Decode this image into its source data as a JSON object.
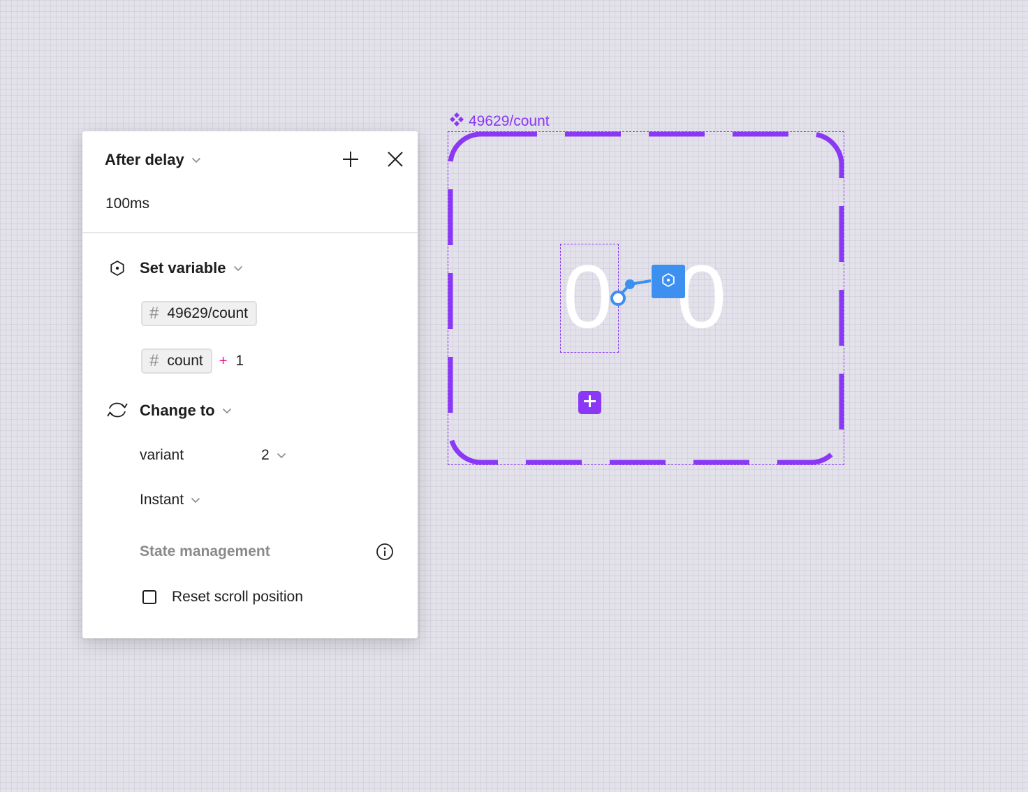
{
  "panel": {
    "trigger": {
      "label": "After delay",
      "delay_value": "100ms"
    },
    "set_variable": {
      "label": "Set variable",
      "target_variable": "49629/count",
      "expression": {
        "variable": "count",
        "operator": "+",
        "operand": "1"
      }
    },
    "change_to": {
      "label": "Change to",
      "property_label": "variant",
      "property_value": "2",
      "animation": "Instant"
    },
    "state_management": {
      "label": "State management",
      "reset_scroll_label": "Reset scroll position",
      "reset_scroll_checked": false
    }
  },
  "canvas": {
    "component_label": "49629/count",
    "digits": [
      "0",
      "0"
    ],
    "accent_color": "#8a38f5",
    "connector_color": "#3d8ff0"
  },
  "icons": {
    "trigger_chevron": "chevron-down-icon",
    "add": "plus-icon",
    "close": "close-icon",
    "set_variable": "hexagon-variable-icon",
    "change_to": "swap-arrows-icon",
    "info": "info-icon",
    "number_type": "hash-icon",
    "component": "component-diamond-icon"
  }
}
